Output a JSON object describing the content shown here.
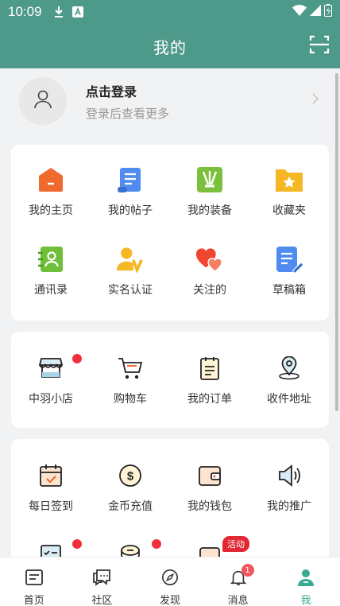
{
  "status": {
    "time": "10:09"
  },
  "header": {
    "title": "我的",
    "scan_icon": "scan-icon"
  },
  "login": {
    "title": "点击登录",
    "subtitle": "登录后查看更多"
  },
  "grid1": [
    {
      "label": "我的主页",
      "icon": "home-icon"
    },
    {
      "label": "我的帖子",
      "icon": "posts-icon"
    },
    {
      "label": "我的装备",
      "icon": "equipment-icon"
    },
    {
      "label": "收藏夹",
      "icon": "favorites-folder-icon"
    },
    {
      "label": "通讯录",
      "icon": "contacts-icon"
    },
    {
      "label": "实名认证",
      "icon": "verify-icon"
    },
    {
      "label": "关注的",
      "icon": "hearts-icon"
    },
    {
      "label": "草稿箱",
      "icon": "draft-icon"
    }
  ],
  "grid2": [
    {
      "label": "中羽小店",
      "icon": "shop-icon"
    },
    {
      "label": "购物车",
      "icon": "cart-icon"
    },
    {
      "label": "我的订单",
      "icon": "orders-icon"
    },
    {
      "label": "收件地址",
      "icon": "location-icon"
    }
  ],
  "grid3": [
    {
      "label": "每日签到",
      "icon": "calendar-check-icon"
    },
    {
      "label": "金币充值",
      "icon": "coin-icon"
    },
    {
      "label": "我的钱包",
      "icon": "wallet-icon"
    },
    {
      "label": "我的推广",
      "icon": "speaker-icon"
    }
  ],
  "grid3_partial_tag": "活动",
  "tabbar": [
    {
      "label": "首页",
      "icon": "home-tab-icon"
    },
    {
      "label": "社区",
      "icon": "community-icon"
    },
    {
      "label": "发现",
      "icon": "compass-icon"
    },
    {
      "label": "消息",
      "icon": "bell-icon",
      "badge": "1"
    },
    {
      "label": "我",
      "icon": "profile-icon"
    }
  ],
  "colors": {
    "brand": "#4d9a8a",
    "active_tab": "#3aa994",
    "dot": "#f0303a"
  }
}
